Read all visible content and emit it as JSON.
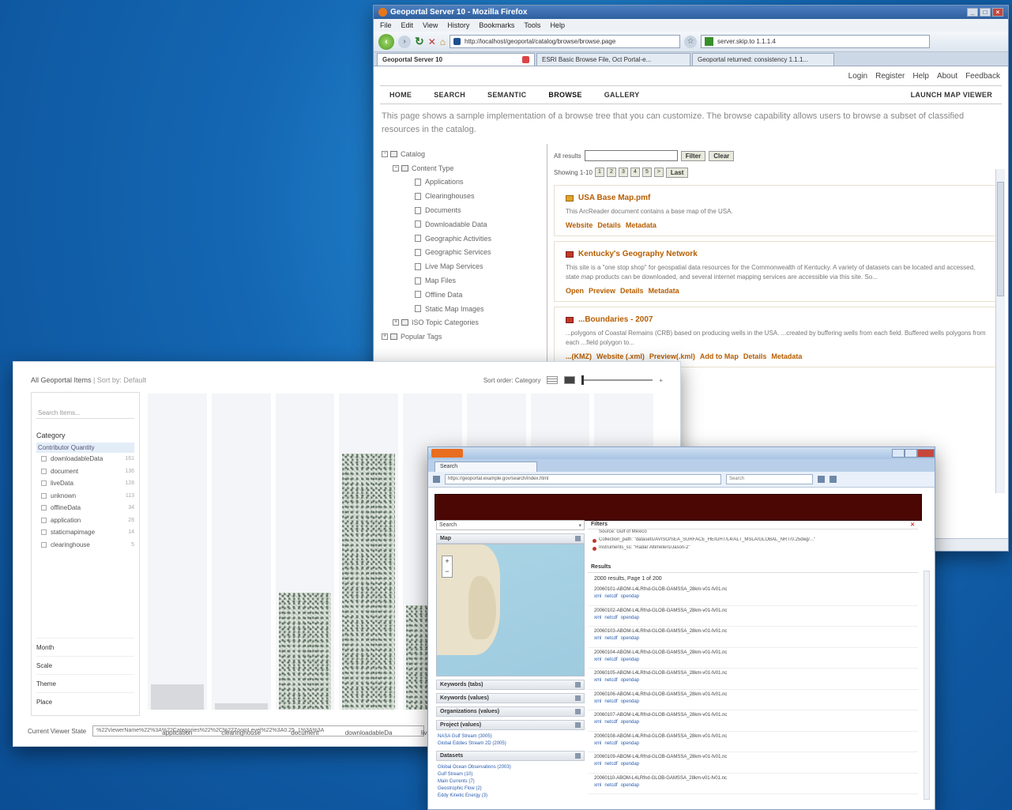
{
  "w1": {
    "title": "Geoportal Server 10 - Mozilla Firefox",
    "menu": [
      "File",
      "Edit",
      "View",
      "History",
      "Bookmarks",
      "Tools",
      "Help"
    ],
    "url": "http://localhost/geoportal/catalog/browse/browse.page",
    "search_value": "server.skip.to 1.1.1.4",
    "tabs": [
      "Geoportal Server 10",
      "ESRI Basic Browse File, Oct Portal-e...",
      "Geoportal returned: consistency 1.1.1..."
    ],
    "toplinks": [
      "Login",
      "Register",
      "Help",
      "About",
      "Feedback"
    ],
    "nav": [
      "HOME",
      "SEARCH",
      "SEMANTIC",
      "BROWSE",
      "GALLERY"
    ],
    "launch": "LAUNCH MAP VIEWER",
    "intro": "This page shows a sample implementation of a browse tree that you can customize. The browse capability allows users to browse a subset of classified resources in the catalog.",
    "tree": {
      "root": "Catalog",
      "content_type": "Content Type",
      "items": [
        "Applications",
        "Clearinghouses",
        "Documents",
        "Downloadable Data",
        "Geographic Activities",
        "Geographic Services",
        "Live Map Services",
        "Map Files",
        "Offline Data",
        "Static Map Images"
      ],
      "iso": "ISO Topic Categories",
      "popular": "Popular Tags"
    },
    "filter_label": "All results",
    "filter_btn": "Filter",
    "clear_btn": "Clear",
    "showing": "Showing 1-10",
    "pages": [
      "1",
      "2",
      "3",
      "4",
      "5",
      ">"
    ],
    "last_btn": "Last",
    "records": [
      {
        "title": "USA Base Map.pmf",
        "desc": "This ArcReader document contains a base map of the USA.",
        "links": [
          "Website",
          "Details",
          "Metadata"
        ]
      },
      {
        "title": "Kentucky's Geography Network",
        "desc": "This site is a \"one stop shop\" for geospatial data resources for the Commonwealth of Kentucky. A variety of datasets can be located and accessed, state map products can be downloaded, and several internet mapping services are accessible via this site. So...",
        "links": [
          "Open",
          "Preview",
          "Details",
          "Metadata"
        ]
      },
      {
        "title": "...Boundaries - 2007",
        "desc": "...polygons of Coastal Remains (CRB) based on producing wells in the USA. ...created by buffering wells from each field. Buffered wells polygons from each ...field polygon to...",
        "links": [
          "...(KMZ)",
          "Website (.xml)",
          "Preview(.kml)",
          "Add to Map",
          "Details",
          "Metadata"
        ]
      }
    ]
  },
  "w2": {
    "title": "All Geoportal Items",
    "title_suffix": "| Sort by: Default",
    "sort": "Sort order: Category",
    "facet_search_placeholder": "Search Items...",
    "facet_category": "Category",
    "facet_selected": "Contributor Quantity",
    "facet_items": [
      {
        "label": "downloadableData",
        "count": "161"
      },
      {
        "label": "document",
        "count": "136"
      },
      {
        "label": "liveData",
        "count": "128"
      },
      {
        "label": "unknown",
        "count": "113"
      },
      {
        "label": "offlineData",
        "count": "34"
      },
      {
        "label": "application",
        "count": "28"
      },
      {
        "label": "staticmapimage",
        "count": "14"
      },
      {
        "label": "clearinghouse",
        "count": "5"
      }
    ],
    "facet_groups": [
      "Month",
      "Scale",
      "Theme",
      "Place"
    ],
    "columns": [
      {
        "label": "application",
        "fill": 0.08,
        "plain": true
      },
      {
        "label": "clearinghouse",
        "fill": 0.02,
        "plain": true
      },
      {
        "label": "document",
        "fill": 0.37,
        "plain": false
      },
      {
        "label": "downloadableDa",
        "fill": 0.81,
        "plain": false
      },
      {
        "label": "liveData",
        "fill": 0.33,
        "plain": false
      },
      {
        "label": "",
        "fill": 0.0,
        "plain": false
      },
      {
        "label": "",
        "fill": 0.0,
        "plain": false
      },
      {
        "label": "",
        "fill": 0.0,
        "plain": false
      }
    ],
    "state_label": "Current Viewer State",
    "state_value": "%22ViewerName%22%3A%22Categories%22%2C%22ZoomLevel%22%3A0.25_1%3A%3A"
  },
  "w3": {
    "tab": "Search",
    "address": "https://geoportal.example.gov/search/index.html",
    "search_placeholder": "Search",
    "search_value": "Search",
    "map_panel": "Map",
    "panels": [
      "Keywords (tabs)",
      "Keywords (values)",
      "Organizations (values)",
      "Project (values)"
    ],
    "project_links": [
      "NASA Gulf Stream (3005)",
      "Global Eddies Stream 2D (2005)"
    ],
    "datasets_panel": "Datasets",
    "dataset_links": [
      "Global Ocean Observations (2003)",
      "Gulf Stream (10)",
      "Main Currents (7)",
      "Geostrophic Flow (2)",
      "Eddy Kinetic Energy (3)"
    ],
    "filters_title": "Filters",
    "filter_lines": [
      "Source: Gulf of Mexico",
      "Collection_path: \"datasets/AVISO/SEA_SURFACE_HEIGHT/L4/ALT_MSLA/GLOBAL_NRT/0.25deg/...\"",
      "Instruments_ss: \"Radar Altimeters/Jason-2\""
    ],
    "results_title": "Results",
    "results_count": "2000 results, Page 1 of 200",
    "result_items": [
      {
        "text": "20060101-ABOM-L4LRfnd-GLOB-GAMSSA_28km-v01-fv01.nc",
        "links": [
          "xml",
          "netcdf",
          "opendap"
        ]
      },
      {
        "text": "20060102-ABOM-L4LRfnd-GLOB-GAMSSA_28km-v01-fv01.nc",
        "links": [
          "xml",
          "netcdf",
          "opendap"
        ]
      },
      {
        "text": "20060103-ABOM-L4LRfnd-GLOB-GAMSSA_28km-v01-fv01.nc",
        "links": [
          "xml",
          "netcdf",
          "opendap"
        ]
      },
      {
        "text": "20060104-ABOM-L4LRfnd-GLOB-GAMSSA_28km-v01-fv01.nc",
        "links": [
          "xml",
          "netcdf",
          "opendap"
        ]
      },
      {
        "text": "20060105-ABOM-L4LRfnd-GLOB-GAMSSA_28km-v01-fv01.nc",
        "links": [
          "xml",
          "netcdf",
          "opendap"
        ]
      },
      {
        "text": "20060106-ABOM-L4LRfnd-GLOB-GAMSSA_28km-v01-fv01.nc",
        "links": [
          "xml",
          "netcdf",
          "opendap"
        ]
      },
      {
        "text": "20060107-ABOM-L4LRfnd-GLOB-GAMSSA_28km-v01-fv01.nc",
        "links": [
          "xml",
          "netcdf",
          "opendap"
        ]
      },
      {
        "text": "20060108-ABOM-L4LRfnd-GLOB-GAMSSA_28km-v01-fv01.nc",
        "links": [
          "xml",
          "netcdf",
          "opendap"
        ]
      },
      {
        "text": "20060109-ABOM-L4LRfnd-GLOB-GAMSSA_28km-v01-fv01.nc",
        "links": [
          "xml",
          "netcdf",
          "opendap"
        ]
      },
      {
        "text": "20060110-ABOM-L4LRfnd-GLOB-GAMSSA_28km-v01-fv01.nc",
        "links": [
          "xml",
          "netcdf",
          "opendap"
        ]
      }
    ]
  }
}
